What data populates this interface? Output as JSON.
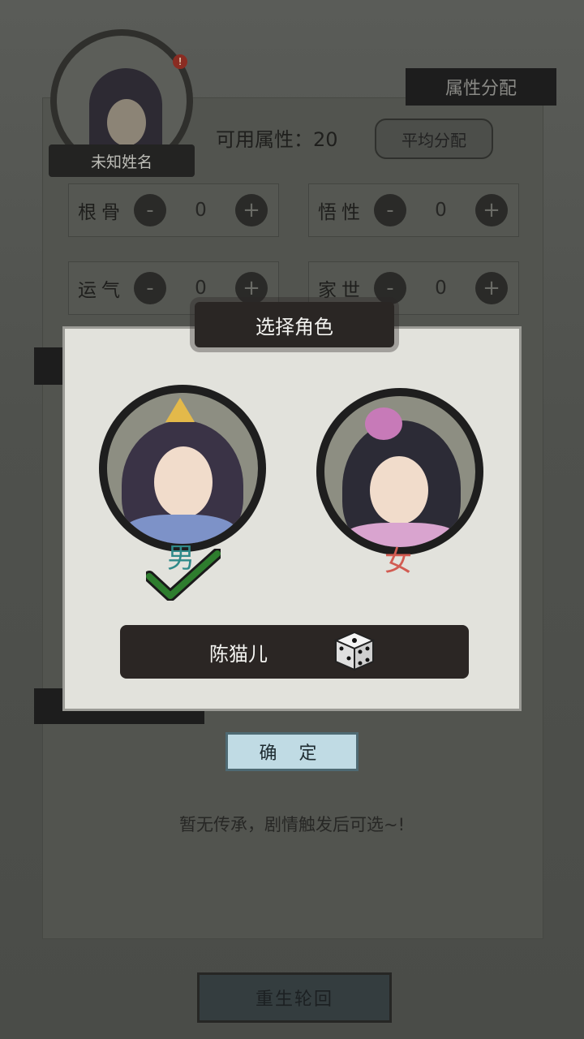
{
  "profile": {
    "name": "未知姓名",
    "notify": "!"
  },
  "attr": {
    "header": "属性分配",
    "available_label": "可用属性：20",
    "average_button": "平均分配",
    "stats": [
      {
        "label": "根骨",
        "value": "0"
      },
      {
        "label": "悟性",
        "value": "0"
      },
      {
        "label": "运气",
        "value": "0"
      },
      {
        "label": "家世",
        "value": "0"
      }
    ],
    "minus": "-",
    "plus": "+"
  },
  "legacy": {
    "empty_text": "暂无传承，剧情触发后可选~!"
  },
  "rebirth_button": "重生轮回",
  "modal": {
    "title": "选择角色",
    "male_label": "男",
    "female_label": "女",
    "selected": "male",
    "character_name": "陈猫儿",
    "confirm_button": "确 定"
  },
  "colors": {
    "check": "#2e7d2e",
    "female_label": "#d25c52",
    "male_label": "#2f8a8a"
  }
}
